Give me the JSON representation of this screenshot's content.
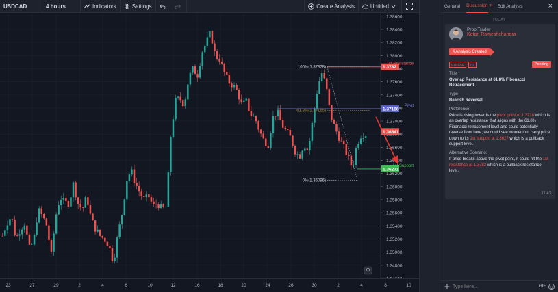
{
  "toolbar": {
    "symbol": "USDCAD",
    "interval": "4 hours",
    "indicators_label": "Indicators",
    "settings_label": "Settings",
    "create_analysis_label": "Create Analysis",
    "layout_label": "Untitled"
  },
  "colors": {
    "bg": "#131722",
    "up": "#26a69a",
    "down": "#ef5350",
    "resistance": "#ef5350",
    "pivot": "#7b7fd6",
    "support": "#3dbb55",
    "accent": "#ef5350"
  },
  "chart_data": {
    "type": "candlestick",
    "symbol": "USDCAD",
    "ylim": [
      1.346,
      1.3865
    ],
    "price_ticks": [
      "1.38600",
      "1.38400",
      "1.38200",
      "1.38000",
      "1.37800",
      "1.37600",
      "1.37400",
      "1.37200",
      "1.37000",
      "1.36800",
      "1.36600",
      "1.36400",
      "1.36200",
      "1.36000",
      "1.35800",
      "1.35600",
      "1.35400",
      "1.35200",
      "1.35000",
      "1.34800",
      "1.34600"
    ],
    "date_ticks": [
      "23",
      "27",
      "29",
      "2",
      "4",
      "6",
      "10",
      "12",
      "16",
      "18",
      "20",
      "24",
      "26",
      "30",
      "2",
      "4",
      "8",
      "10"
    ],
    "trend_path": [
      1.3525,
      1.3545,
      1.3555,
      1.352,
      1.3535,
      1.3545,
      1.3505,
      1.3515,
      1.3565,
      1.3555,
      1.354,
      1.3495,
      1.3555,
      1.3585,
      1.3575,
      1.3575,
      1.3605,
      1.3575,
      1.3565,
      1.3585,
      1.355,
      1.3535,
      1.3525,
      1.352,
      1.351,
      1.3485,
      1.3525,
      1.356,
      1.361,
      1.3625,
      1.3605,
      1.359,
      1.358,
      1.3585,
      1.357,
      1.3575,
      1.3565,
      1.357,
      1.368,
      1.373,
      1.3735,
      1.3725,
      1.3765,
      1.378,
      1.377,
      1.3805,
      1.382,
      1.3835,
      1.38,
      1.3795,
      1.3775,
      1.376,
      1.3755,
      1.3745,
      1.3725,
      1.373,
      1.371,
      1.3705,
      1.3685,
      1.367,
      1.3665,
      1.3705,
      1.3715,
      1.3695,
      1.3685,
      1.3675,
      1.3655,
      1.3645,
      1.3665,
      1.3655,
      1.37,
      1.3745,
      1.3775,
      1.3755,
      1.371,
      1.369,
      1.3675,
      1.366,
      1.3645,
      1.3628,
      1.3665,
      1.368,
      1.368
    ],
    "current_price": "1.36841",
    "levels": {
      "resistance": {
        "label": "1st Resistance",
        "value": "1.37828",
        "tag": "1.3782"
      },
      "pivot": {
        "label": "Pivot",
        "value": "1.37188",
        "tag": "1.37188"
      },
      "support": {
        "label": "1st Support",
        "value": "1.36271",
        "tag": "1.36271"
      }
    },
    "fib": {
      "top": "100%(1.37828)",
      "mid": "61.8%(1.37165)",
      "bottom": "0%(1.36096)"
    }
  },
  "panel": {
    "tabs": [
      "General",
      "Discussion",
      "Edit Analysis"
    ],
    "active_tab": "Discussion",
    "close_glyph": "×",
    "today_label": "TODAY",
    "trader_role": "Prop Trader",
    "trader_name": "Ketan Rameshchandra",
    "analysis_created": "Analysis Created",
    "tag_symbol": "USDCAD",
    "tag_interval": "H4",
    "status": "Pending",
    "title_label": "Title",
    "title_value": "Overlap Resistance at 61.8% Fibonacci Retracement",
    "type_label": "Type",
    "type_value": "Bearish Reversal",
    "preference_label": "Preference:",
    "preference_parts": [
      "Price is rising towards the ",
      "pivot point of 1.3718",
      " which is an overlap resistance that aligns with the 61.8% Fibonacci retracement level and could potentially reverse from here; we could see momentum carry price down to its ",
      "1st support at 1.3627",
      " which is a pullback support level."
    ],
    "alt_label": "Alternative Scenario:",
    "alt_parts": [
      "If price breaks above the pivot point, it could hit the ",
      "1st resistance at 1.3782",
      " which is a pullback resistance level."
    ],
    "time": "11:43",
    "input_placeholder": "Type here...",
    "gif_label": "GIF"
  }
}
